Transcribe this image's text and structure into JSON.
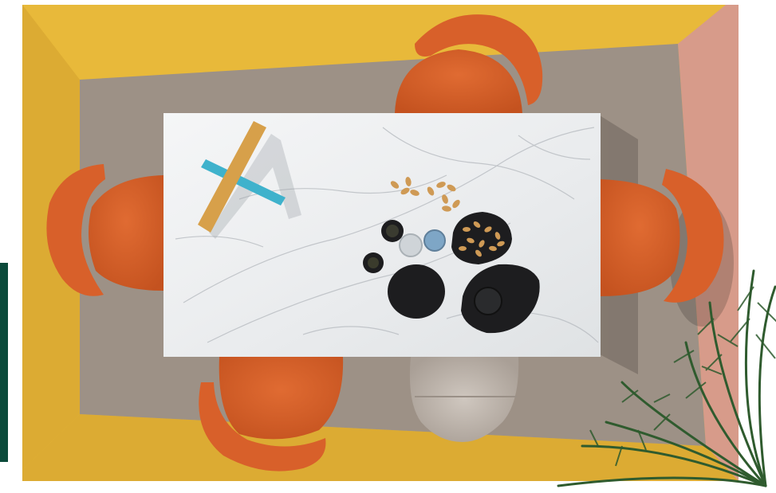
{
  "photo": {
    "subject": "top-down-dining-set",
    "colors": {
      "background": "#ffffff",
      "rug_gold": "#e8b93a",
      "rug_left": "#dcab33",
      "rug_pink": "#d79b8a",
      "rug_grey": "#9d9186",
      "marble": "#eceeef",
      "chair_orange": "#d8602a",
      "chair_shade": "#b64a1e",
      "stool_grey": "#c4bcb4",
      "ceramic_black": "#1d1d1f",
      "wood": "#d7a04a",
      "teal_piece": "#3fb2cc",
      "peanut": "#cf9a55",
      "palm_green": "#2f5b2e",
      "edge_green": "#0b4a3a"
    }
  }
}
